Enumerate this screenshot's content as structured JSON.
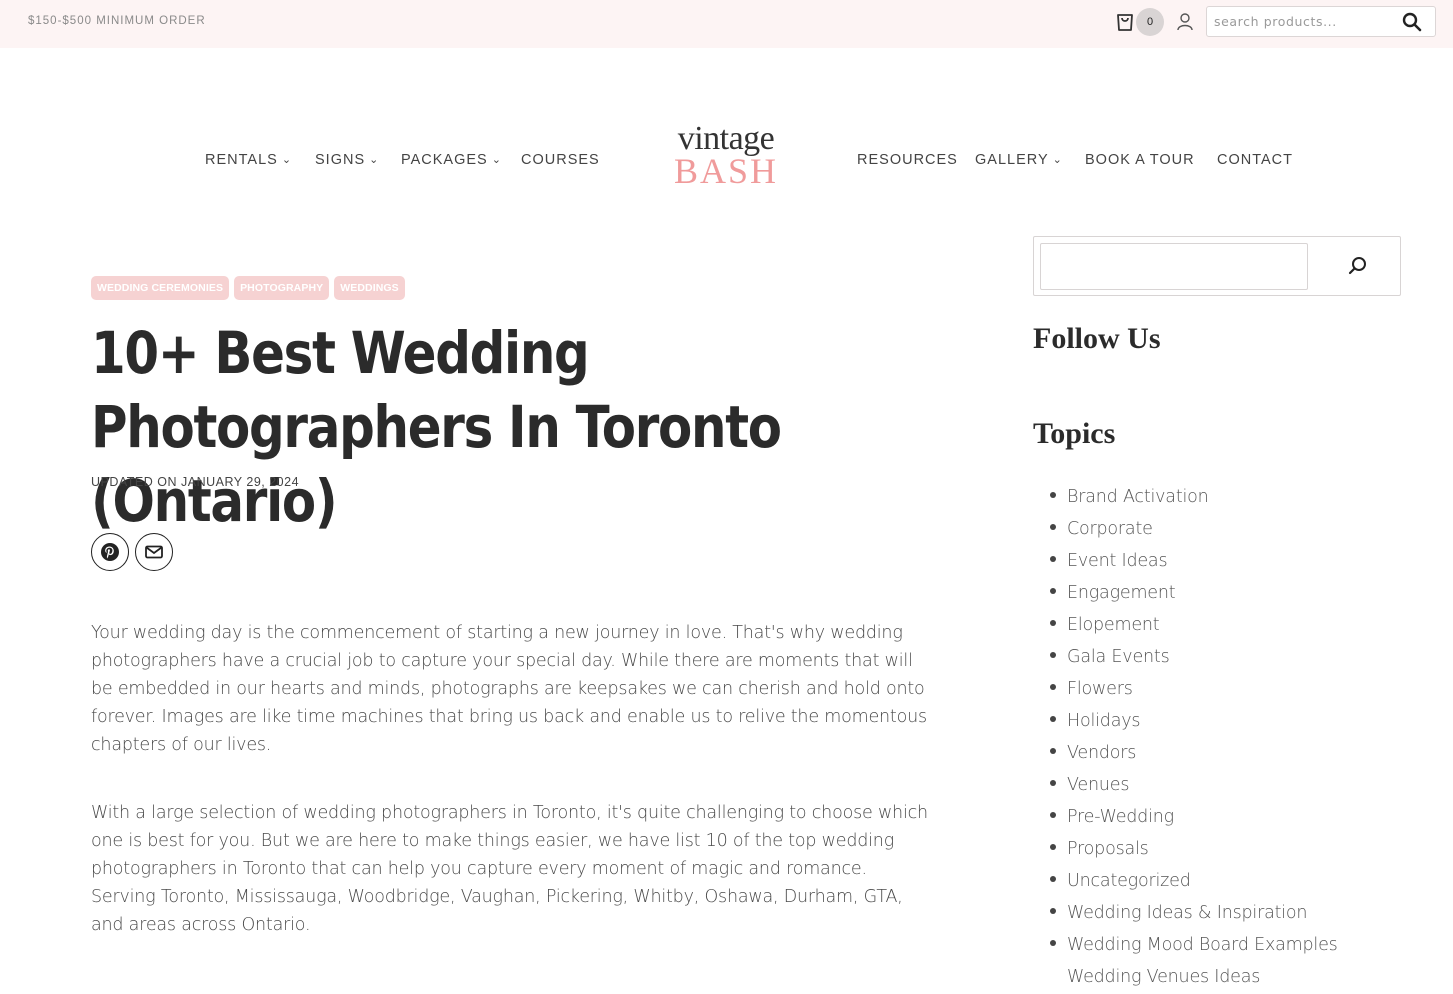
{
  "topbar": {
    "promo": "$150-$500 MINIMUM ORDER",
    "cart_count": "0",
    "search_placeholder": "search products..."
  },
  "nav": {
    "left": [
      {
        "label": "RENTALS",
        "dropdown": true
      },
      {
        "label": "SIGNS",
        "dropdown": true
      },
      {
        "label": "PACKAGES",
        "dropdown": true
      },
      {
        "label": "COURSES",
        "dropdown": false
      }
    ],
    "right": [
      {
        "label": "RESOURCES",
        "dropdown": false
      },
      {
        "label": "GALLERY",
        "dropdown": true
      },
      {
        "label": "BOOK A TOUR",
        "dropdown": false
      },
      {
        "label": "CONTACT",
        "dropdown": false
      }
    ]
  },
  "logo": {
    "line1": "vintage",
    "line2": "BASH",
    "accent_color": "#f09b9b"
  },
  "article": {
    "tags": [
      "WEDDING CEREMONIES",
      "PHOTOGRAPHY",
      "WEDDINGS"
    ],
    "title": "10+ Best Wedding Photographers In Toronto (Ontario)",
    "updated": "UPDATED ON JANUARY 29, 2024",
    "share_icons": [
      "pinterest-icon",
      "email-icon"
    ],
    "paragraphs": [
      "Your wedding day is the commencement of starting a new journey in love. That's why wedding photographers have a crucial job to capture your special day. While there are moments that will be embedded in our hearts and minds, photographs are keepsakes we can cherish and hold onto forever. Images are like time machines that bring us back and enable us to relive the momentous chapters of our lives.",
      "With a large selection of wedding photographers in Toronto, it's quite challenging to choose which one is best for you. But we are here to make things easier, we have list 10 of the top wedding photographers in Toronto that can help you capture every moment of magic and romance. Serving Toronto, Mississauga, Woodbridge, Vaughan, Pickering, Whitby, Oshawa, Durham, GTA, and areas across Ontario."
    ]
  },
  "sidebar": {
    "follow_title": "Follow Us",
    "topics_title": "Topics",
    "topics": [
      "Brand Activation",
      "Corporate",
      "Event Ideas",
      "Engagement",
      "Elopement",
      "Gala Events",
      "Flowers",
      "Holidays",
      "Vendors",
      "Venues",
      "Pre-Wedding",
      "Proposals",
      "Uncategorized",
      "Wedding Ideas & Inspiration",
      "Wedding Mood Board Examples",
      "Wedding Venues Ideas"
    ]
  }
}
